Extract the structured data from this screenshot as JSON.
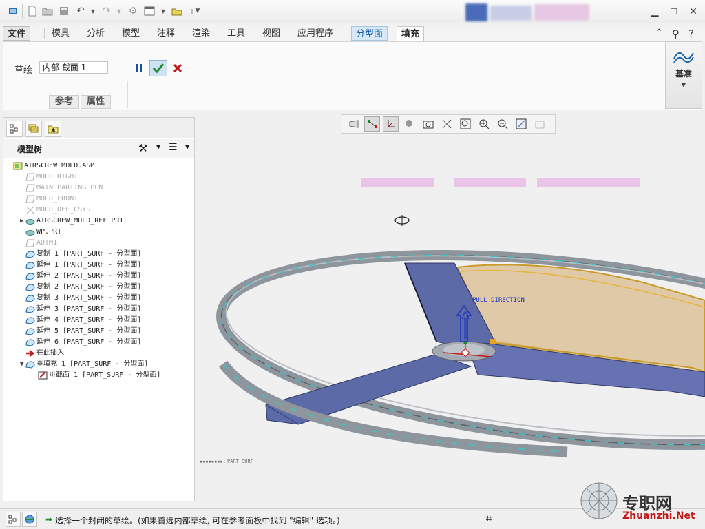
{
  "ribbon_tabs": [
    "文件",
    "模具",
    "分析",
    "模型",
    "注释",
    "渲染",
    "工具",
    "视图",
    "应用程序",
    "分型面",
    "填充"
  ],
  "ribbon": {
    "sketch_label": "草绘",
    "sketch_value": "内部 截面 1",
    "subtabs": [
      "参考",
      "属性"
    ],
    "datum_label": "基准"
  },
  "model_tree": {
    "title": "模型树",
    "items": [
      {
        "label": "AIRSCREW_MOLD.ASM",
        "icon": "assembly-icon",
        "indent": 0,
        "gray": false
      },
      {
        "label": "MOLD_RIGHT",
        "icon": "datum-plane-icon",
        "indent": 1,
        "gray": true
      },
      {
        "label": "MAIN_PARTING_PLN",
        "icon": "datum-plane-icon",
        "indent": 1,
        "gray": true
      },
      {
        "label": "MOLD_FRONT",
        "icon": "datum-plane-icon",
        "indent": 1,
        "gray": true
      },
      {
        "label": "MOLD_DEF_CSYS",
        "icon": "csys-icon",
        "indent": 1,
        "gray": true
      },
      {
        "label": "AIRSCREW_MOLD_REF.PRT",
        "icon": "part-icon",
        "indent": 1,
        "gray": false,
        "expander": "▶"
      },
      {
        "label": "WP.PRT",
        "icon": "part-icon",
        "indent": 1,
        "gray": false
      },
      {
        "label": "ADTM1",
        "icon": "datum-plane-icon",
        "indent": 1,
        "gray": true
      },
      {
        "label": "复制 1 [PART_SURF - 分型面]",
        "icon": "surface-icon",
        "indent": 1,
        "gray": false
      },
      {
        "label": "延伸 1 [PART_SURF - 分型面]",
        "icon": "surface-icon",
        "indent": 1,
        "gray": false
      },
      {
        "label": "延伸 2 [PART_SURF - 分型面]",
        "icon": "surface-icon",
        "indent": 1,
        "gray": false
      },
      {
        "label": "复制 2 [PART_SURF - 分型面]",
        "icon": "surface-icon",
        "indent": 1,
        "gray": false
      },
      {
        "label": "复制 3 [PART_SURF - 分型面]",
        "icon": "surface-icon",
        "indent": 1,
        "gray": false
      },
      {
        "label": "延伸 3 [PART_SURF - 分型面]",
        "icon": "surface-icon",
        "indent": 1,
        "gray": false
      },
      {
        "label": "延伸 4 [PART_SURF - 分型面]",
        "icon": "surface-icon",
        "indent": 1,
        "gray": false
      },
      {
        "label": "延伸 5 [PART_SURF - 分型面]",
        "icon": "surface-icon",
        "indent": 1,
        "gray": false
      },
      {
        "label": "延伸 6 [PART_SURF - 分型面]",
        "icon": "surface-icon",
        "indent": 1,
        "gray": false
      },
      {
        "label": "在此插入",
        "icon": "insert-arrow-icon",
        "indent": 1,
        "gray": false
      },
      {
        "label": "※填充 1 [PART_SURF - 分型面]",
        "icon": "surface-icon",
        "indent": 1,
        "gray": false,
        "expander": "▼"
      },
      {
        "label": "※截面 1 [PART_SURF - 分型面]",
        "icon": "sketch-icon",
        "indent": 2,
        "gray": false
      }
    ]
  },
  "viewport": {
    "pull_direction": "PULL DIRECTION",
    "layer_label": "PART_SURF"
  },
  "status": {
    "message": "选择一个封闭的草绘。(如果首选内部草绘, 可在参考面板中找到 \"编辑\" 选项。)"
  },
  "watermark": {
    "brand": "专职网",
    "url": "Zhuanzhi.Net"
  },
  "colors": {
    "accent": "#1a64ad",
    "surface_fill": "#e0c9a6",
    "blade_blue": "#5c6aa8",
    "ring_gray": "#8f959d"
  }
}
